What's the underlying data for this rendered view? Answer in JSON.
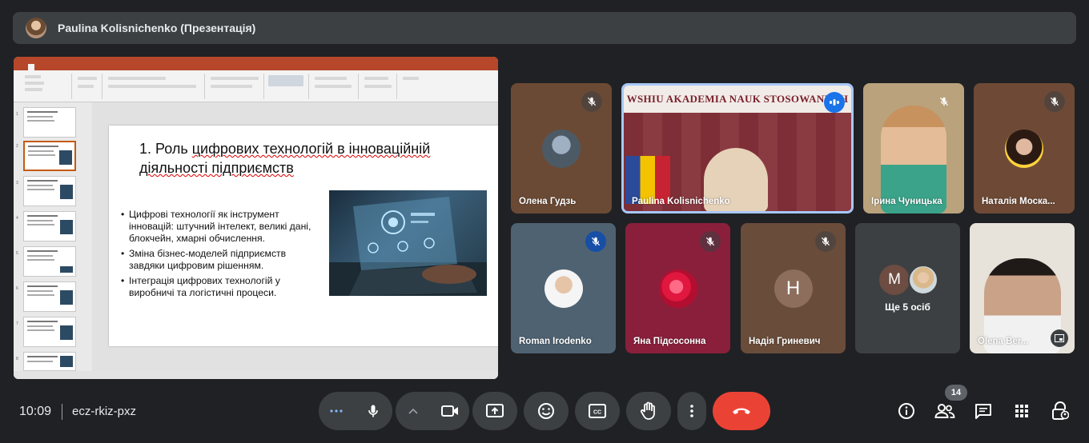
{
  "presenter": {
    "title": "Paulina Kolisnichenko (Презентація)"
  },
  "presentation": {
    "slide": {
      "title_before": "1. Роль ",
      "title_highlight": "цифрових технологій в інноваційній",
      "title_line2": "діяльності підприємств",
      "bullets": [
        "Цифрові технології як інструмент інновацій: штучний інтелект, великі дані, блокчейн, хмарні обчислення.",
        "Зміна бізнес-моделей підприємств завдяки цифровим рішенням.",
        "Інтеграція цифрових технологій у виробничі та логістичні процеси."
      ]
    }
  },
  "participants": [
    {
      "name": "Олена Гудзь",
      "muted": true
    },
    {
      "name": "Paulina Kolisnichenko",
      "muted": false,
      "speaking": true,
      "banner": "WSHIU AKADEMIA NAUK STOSOWANYCH"
    },
    {
      "name": "Ірина Чуницька",
      "muted": true
    },
    {
      "name": "Наталія Моска...",
      "muted": true
    },
    {
      "name": "Roman Irodenko",
      "muted": true
    },
    {
      "name": "Яна Підсосонна",
      "muted": true
    },
    {
      "name": "Надія Гриневич",
      "muted": true,
      "initial": "Н"
    },
    {
      "name": "Olena Ber...",
      "muted": false
    },
    {
      "name": "Ще 5 осіб",
      "initial": "М"
    }
  ],
  "bottom_bar": {
    "time": "10:09",
    "meeting_code": "ecz-rkiz-pxz",
    "people_count": "14"
  },
  "colors": {
    "background": "#202124",
    "hangup": "#ea4335",
    "tile": "#3c4043",
    "muted_badge_blue": "#174ea6"
  }
}
